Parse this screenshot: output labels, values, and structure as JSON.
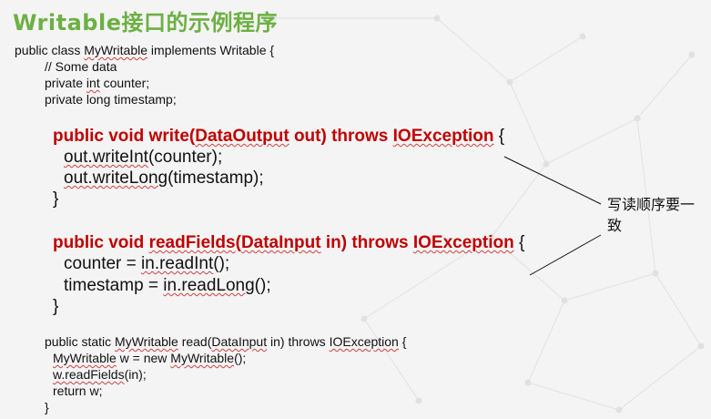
{
  "slide": {
    "title": "Writable接口的示例程序"
  },
  "code": {
    "class_decl": {
      "pre": "public class ",
      "name": "MyWritable",
      "post": " implements Writable {"
    },
    "comment": "// Some data",
    "field_counter": {
      "pre": "private ",
      "type": "int",
      "post": " counter;"
    },
    "field_timestamp": "private long timestamp;",
    "write_method": {
      "sig_a": "public void write(",
      "sig_b": "DataOutput",
      "sig_c": " out) throws ",
      "sig_d": "IOException",
      "brace": " {",
      "line1": "out.writeInt",
      "line1_rest": "(counter);",
      "line2": "out.writeLong",
      "line2_rest": "(timestamp);",
      "close": "}"
    },
    "read_method": {
      "sig_a": "public void ",
      "sig_b": "readFields",
      "sig_c": "(",
      "sig_d": "DataInput",
      "sig_e": " in) throws ",
      "sig_f": "IOException",
      "brace": " {",
      "line1_pre": "counter = ",
      "line1": "in.readInt",
      "line1_rest": "();",
      "line2_pre": "timestamp = ",
      "line2": "in.readLong",
      "line2_rest": "();",
      "close": "}"
    },
    "static_method": {
      "sig_a": "public static ",
      "sig_b": "MyWritable",
      "sig_c": " read(",
      "sig_d": "DataInput",
      "sig_e": " in) throws ",
      "sig_f": "IOException",
      "brace": " {",
      "line1_a": "MyWritable",
      "line1_b": " w = new ",
      "line1_c": "MyWritable",
      "line1_d": "();",
      "line2_a": "w.readFields",
      "line2_b": "(in);",
      "line3": "return w;",
      "close": "}"
    }
  },
  "annotation": {
    "text": "写读顺序要一致"
  }
}
